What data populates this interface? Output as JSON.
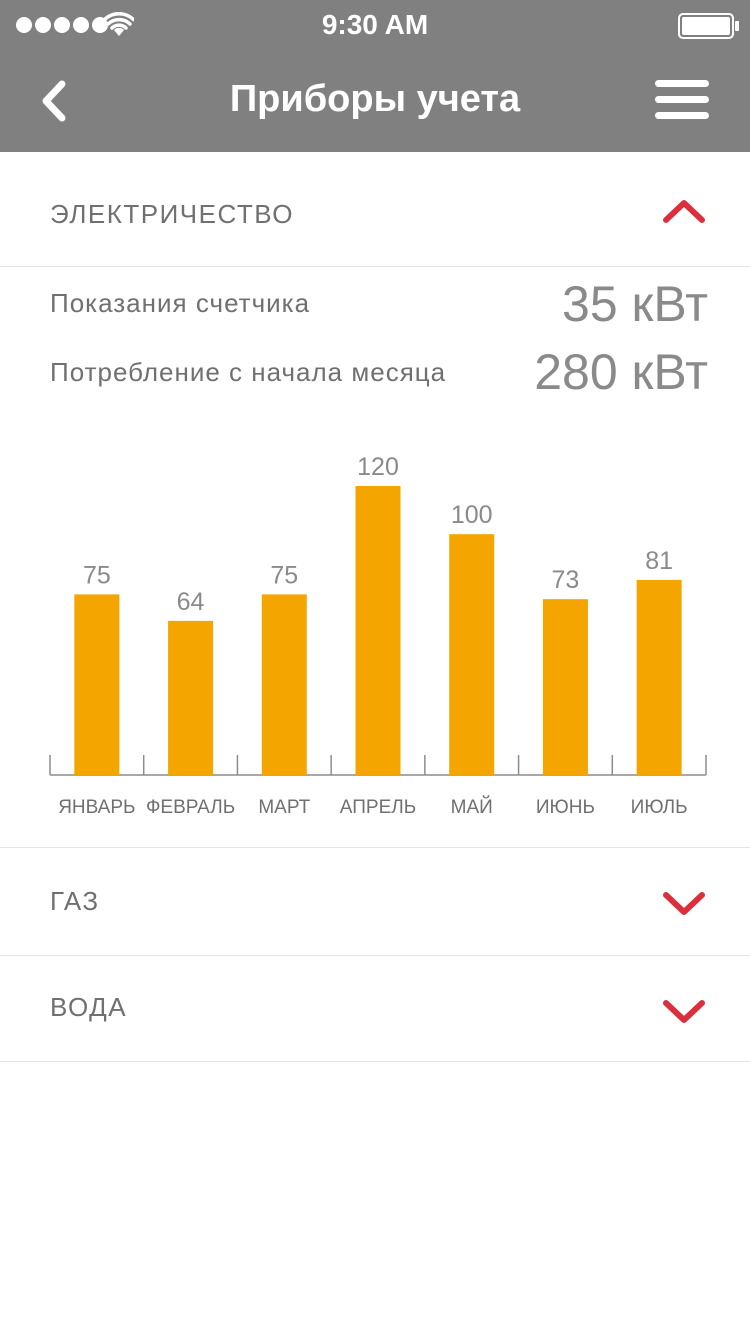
{
  "status_bar": {
    "time": "9:30 AM"
  },
  "header": {
    "title": "Приборы учета"
  },
  "sections": {
    "electricity": {
      "title": "ЭЛЕКТРИЧЕСТВО"
    },
    "gas": {
      "title": "ГАЗ"
    },
    "water": {
      "title": "ВОДА"
    }
  },
  "stats": {
    "meter_label": "Показания счетчика",
    "meter_value": "35 кВт",
    "consumption_label": "Потребление с начала месяца",
    "consumption_value": "280 кВт"
  },
  "colors": {
    "header_bg": "#808080",
    "bar": "#F5A500",
    "chevron": "#DC2F3C",
    "text_gray": "#707070"
  },
  "chart_data": {
    "type": "bar",
    "categories": [
      "ЯНВАРЬ",
      "ФЕВРАЛЬ",
      "МАРТ",
      "АПРЕЛЬ",
      "МАЙ",
      "ИЮНЬ",
      "ИЮЛЬ"
    ],
    "values": [
      75,
      64,
      75,
      120,
      100,
      73,
      81
    ],
    "title": "",
    "xlabel": "",
    "ylabel": "",
    "ylim": [
      0,
      120
    ],
    "grid": false,
    "data_labels": true
  }
}
